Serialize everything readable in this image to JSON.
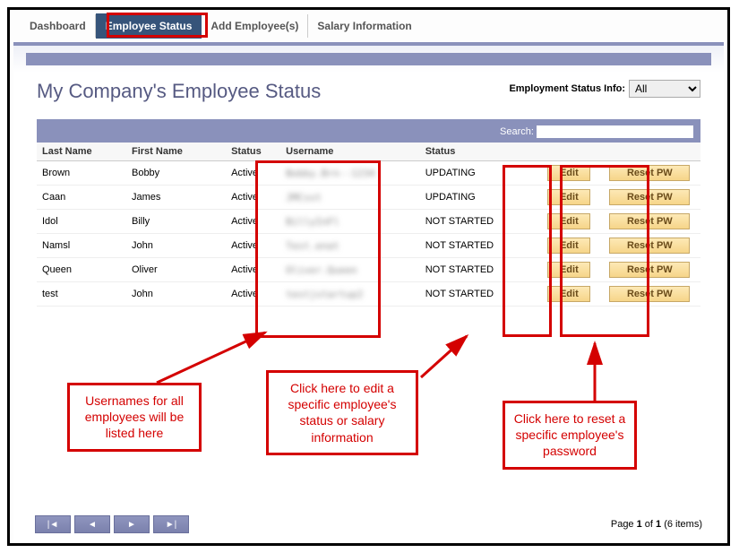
{
  "tabs": {
    "dashboard": "Dashboard",
    "employee_status": "Employee Status",
    "add_employees": "Add Employee(s)",
    "salary_info": "Salary Information"
  },
  "page_title": "My Company's Employee Status",
  "filter": {
    "label": "Employment Status Info:",
    "value": "All"
  },
  "search": {
    "label": "Search:",
    "value": ""
  },
  "columns": {
    "last_name": "Last Name",
    "first_name": "First Name",
    "status1": "Status",
    "username": "Username",
    "status2": "Status"
  },
  "buttons": {
    "edit": "Edit",
    "reset_pw": "Reset PW"
  },
  "rows": [
    {
      "last": "Brown",
      "first": "Bobby",
      "status1": "Active",
      "username": "Bobby.Brn--1234",
      "status2": "UPDATING"
    },
    {
      "last": "Caan",
      "first": "James",
      "status1": "Active",
      "username": "JMCsst",
      "status2": "UPDATING"
    },
    {
      "last": "Idol",
      "first": "Billy",
      "status1": "Active",
      "username": "BillyInFl",
      "status2": "NOT STARTED"
    },
    {
      "last": "Namsl",
      "first": "John",
      "status1": "Active",
      "username": "Test.enat",
      "status2": "NOT STARTED"
    },
    {
      "last": "Queen",
      "first": "Oliver",
      "status1": "Active",
      "username": "Oliver.Queen",
      "status2": "NOT STARTED"
    },
    {
      "last": "test",
      "first": "John",
      "status1": "Active",
      "username": "testjstartup2",
      "status2": "NOT STARTED"
    }
  ],
  "pager": {
    "text_prefix": "Page ",
    "page": "1",
    "of": " of ",
    "total_pages": "1",
    "items_suffix": " (6 items)"
  },
  "annotations": {
    "usernames": "Usernames for all employees will be listed here",
    "edit": "Click here to edit a specific employee's status or salary information",
    "reset": "Click here to reset a specific employee's password"
  }
}
